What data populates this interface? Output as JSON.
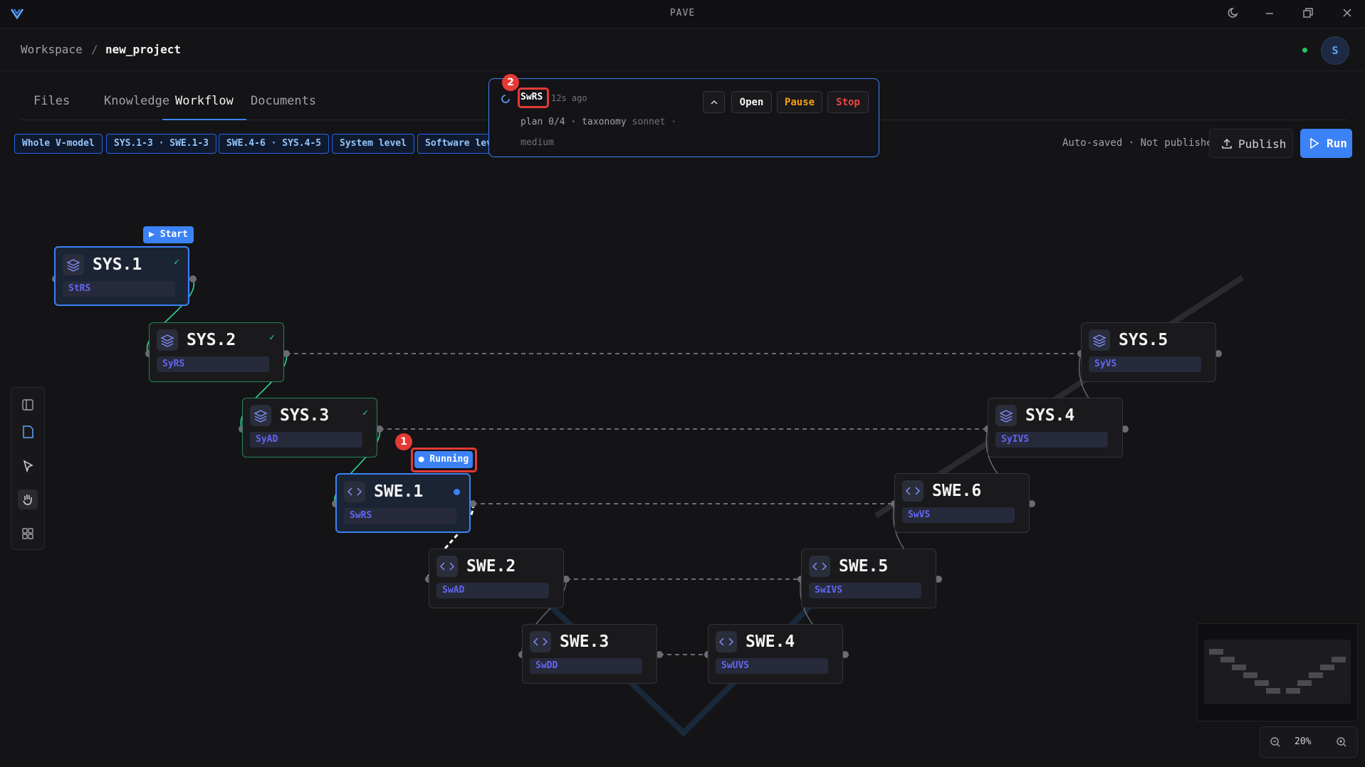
{
  "app": {
    "title": "PAVE",
    "theme_icon": "moon-icon"
  },
  "breadcrumb": {
    "workspace": "Workspace",
    "separator": "/",
    "project": "new_project"
  },
  "user": {
    "avatar_initial": "S",
    "status": "online"
  },
  "tabs": [
    {
      "label": "Files",
      "active": false
    },
    {
      "label": "Knowledge",
      "active": false
    },
    {
      "label": "Workflow",
      "active": true
    },
    {
      "label": "Documents",
      "active": false
    }
  ],
  "filters": [
    {
      "label": "Whole V-model"
    },
    {
      "label": "SYS.1-3 · SWE.1-3"
    },
    {
      "label": "SWE.4-6 · SYS.4-5"
    },
    {
      "label": "System level"
    },
    {
      "label": "Software level"
    }
  ],
  "save_status": "Auto-saved · Not published",
  "actions": {
    "publish": "Publish",
    "run": "Run"
  },
  "badges": {
    "start": "Start",
    "running": "Running"
  },
  "markers": {
    "first": "1",
    "second": "2"
  },
  "nodes": {
    "sys1": {
      "name": "SYS.1",
      "sub": "StRS",
      "status": "done"
    },
    "sys2": {
      "name": "SYS.2",
      "sub": "SyRS",
      "status": "done"
    },
    "sys3": {
      "name": "SYS.3",
      "sub": "SyAD",
      "status": "done"
    },
    "swe1": {
      "name": "SWE.1",
      "sub": "SwRS",
      "status": "running"
    },
    "swe2": {
      "name": "SWE.2",
      "sub": "SwAD",
      "status": "pending"
    },
    "swe3": {
      "name": "SWE.3",
      "sub": "SwDD",
      "status": "pending"
    },
    "swe4": {
      "name": "SWE.4",
      "sub": "SwUVS",
      "status": "pending"
    },
    "swe5": {
      "name": "SWE.5",
      "sub": "SwIVS",
      "status": "pending"
    },
    "swe6": {
      "name": "SWE.6",
      "sub": "SwVS",
      "status": "pending"
    },
    "sys4": {
      "name": "SYS.4",
      "sub": "SyIVS",
      "status": "pending"
    },
    "sys5": {
      "name": "SYS.5",
      "sub": "SyVS",
      "status": "pending"
    }
  },
  "popup": {
    "title": "SwRS",
    "time": "12s ago",
    "line1": "plan 0/4 · taxonomy",
    "model": "sonnet",
    "line1_end": "·",
    "line2": "medium",
    "open": "Open",
    "pause": "Pause",
    "stop": "Stop"
  },
  "zoom": {
    "value": "20%"
  },
  "colors": {
    "accent": "#3b82f6",
    "done": "#22865f",
    "pause": "#f59e0b",
    "stop": "#ef4444",
    "highlight": "#e53935"
  }
}
